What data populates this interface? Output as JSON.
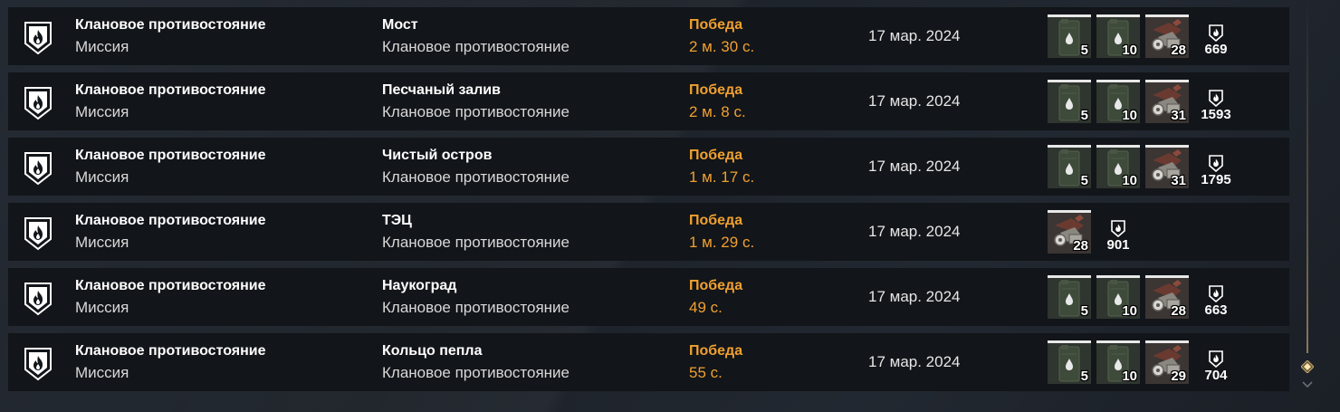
{
  "colors": {
    "row_bg": "#121519",
    "accent_orange": "#f0a030",
    "text_white": "#ffffff",
    "text_secondary": "#d8d8d8"
  },
  "rows": [
    {
      "mode_title": "Клановое противостояние",
      "mode_subtitle": "Миссия",
      "map_name": "Мост",
      "map_mode": "Клановое противостояние",
      "result": "Победа",
      "duration": "2 м. 30 с.",
      "date": "17 мар. 2024",
      "rewards": [
        {
          "icon": "fuel-canister-icon",
          "qty": "5"
        },
        {
          "icon": "fuel-canister-icon",
          "qty": "10"
        },
        {
          "icon": "scrap-parts-icon",
          "qty": "28"
        }
      ],
      "clan_token": "669"
    },
    {
      "mode_title": "Клановое противостояние",
      "mode_subtitle": "Миссия",
      "map_name": "Песчаный залив",
      "map_mode": "Клановое противостояние",
      "result": "Победа",
      "duration": "2 м. 8 с.",
      "date": "17 мар. 2024",
      "rewards": [
        {
          "icon": "fuel-canister-icon",
          "qty": "5"
        },
        {
          "icon": "fuel-canister-icon",
          "qty": "10"
        },
        {
          "icon": "scrap-parts-icon",
          "qty": "31"
        }
      ],
      "clan_token": "1593"
    },
    {
      "mode_title": "Клановое противостояние",
      "mode_subtitle": "Миссия",
      "map_name": "Чистый остров",
      "map_mode": "Клановое противостояние",
      "result": "Победа",
      "duration": "1 м. 17 с.",
      "date": "17 мар. 2024",
      "rewards": [
        {
          "icon": "fuel-canister-icon",
          "qty": "5"
        },
        {
          "icon": "fuel-canister-icon",
          "qty": "10"
        },
        {
          "icon": "scrap-parts-icon",
          "qty": "31"
        }
      ],
      "clan_token": "1795"
    },
    {
      "mode_title": "Клановое противостояние",
      "mode_subtitle": "Миссия",
      "map_name": "ТЭЦ",
      "map_mode": "Клановое противостояние",
      "result": "Победа",
      "duration": "1 м. 29 с.",
      "date": "17 мар. 2024",
      "rewards": [
        {
          "icon": "scrap-parts-icon",
          "qty": "28"
        }
      ],
      "clan_token": "901"
    },
    {
      "mode_title": "Клановое противостояние",
      "mode_subtitle": "Миссия",
      "map_name": "Наукоград",
      "map_mode": "Клановое противостояние",
      "result": "Победа",
      "duration": "49 с.",
      "date": "17 мар. 2024",
      "rewards": [
        {
          "icon": "fuel-canister-icon",
          "qty": "5"
        },
        {
          "icon": "fuel-canister-icon",
          "qty": "10"
        },
        {
          "icon": "scrap-parts-icon",
          "qty": "28"
        }
      ],
      "clan_token": "663"
    },
    {
      "mode_title": "Клановое противостояние",
      "mode_subtitle": "Миссия",
      "map_name": "Кольцо пепла",
      "map_mode": "Клановое противостояние",
      "result": "Победа",
      "duration": "55 с.",
      "date": "17 мар. 2024",
      "rewards": [
        {
          "icon": "fuel-canister-icon",
          "qty": "5"
        },
        {
          "icon": "fuel-canister-icon",
          "qty": "10"
        },
        {
          "icon": "scrap-parts-icon",
          "qty": "29"
        }
      ],
      "clan_token": "704"
    }
  ]
}
